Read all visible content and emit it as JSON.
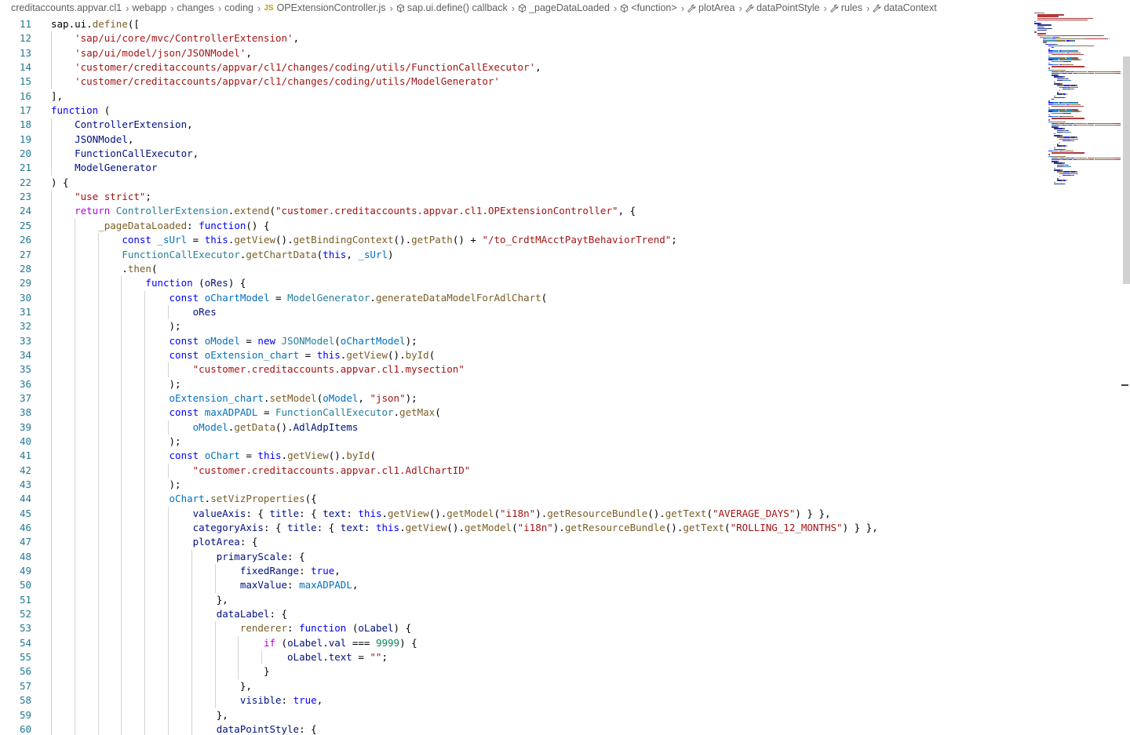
{
  "breadcrumb": [
    {
      "label": "creditaccounts.appvar.cl1",
      "icon": ""
    },
    {
      "label": "webapp",
      "icon": ""
    },
    {
      "label": "changes",
      "icon": ""
    },
    {
      "label": "coding",
      "icon": ""
    },
    {
      "label": "OPExtensionController.js",
      "icon": "js-file-icon"
    },
    {
      "label": "sap.ui.define() callback",
      "icon": "cube-icon"
    },
    {
      "label": "_pageDataLoaded",
      "icon": "cube-icon"
    },
    {
      "label": "<function>",
      "icon": "cube-icon"
    },
    {
      "label": "plotArea",
      "icon": "wrench-icon"
    },
    {
      "label": "dataPointStyle",
      "icon": "wrench-icon"
    },
    {
      "label": "rules",
      "icon": "wrench-icon"
    },
    {
      "label": "dataContext",
      "icon": "wrench-icon"
    }
  ],
  "js_badge": "JS",
  "colors": {
    "keyword": "#0000ff",
    "control": "#af00db",
    "string": "#a31515",
    "number": "#098658",
    "variable": "#0070c1",
    "function": "#795e26",
    "property": "#001080",
    "class": "#267f99",
    "line_number": "#237893"
  },
  "code_lines": [
    {
      "n": "11",
      "indent": 0,
      "tokens": [
        [
          "pl",
          "sap.ui."
        ],
        [
          "fn",
          "define"
        ],
        [
          "pl",
          "(["
        ]
      ]
    },
    {
      "n": "12",
      "indent": 1,
      "tokens": [
        [
          "str",
          "'sap/ui/core/mvc/ControllerExtension'"
        ],
        [
          "pl",
          ","
        ]
      ]
    },
    {
      "n": "13",
      "indent": 1,
      "tokens": [
        [
          "str",
          "'sap/ui/model/json/JSONModel'"
        ],
        [
          "pl",
          ","
        ]
      ]
    },
    {
      "n": "14",
      "indent": 1,
      "tokens": [
        [
          "str",
          "'customer/creditaccounts/appvar/cl1/changes/coding/utils/FunctionCallExecutor'"
        ],
        [
          "pl",
          ","
        ]
      ]
    },
    {
      "n": "15",
      "indent": 1,
      "tokens": [
        [
          "str",
          "'customer/creditaccounts/appvar/cl1/changes/coding/utils/ModelGenerator'"
        ]
      ]
    },
    {
      "n": "16",
      "indent": 0,
      "tokens": [
        [
          "pl",
          "],"
        ]
      ]
    },
    {
      "n": "17",
      "indent": 0,
      "tokens": [
        [
          "key",
          "function"
        ],
        [
          "pl",
          " ("
        ]
      ]
    },
    {
      "n": "18",
      "indent": 1,
      "tokens": [
        [
          "prop",
          "ControllerExtension"
        ],
        [
          "pl",
          ","
        ]
      ]
    },
    {
      "n": "19",
      "indent": 1,
      "tokens": [
        [
          "prop",
          "JSONModel"
        ],
        [
          "pl",
          ","
        ]
      ]
    },
    {
      "n": "20",
      "indent": 1,
      "tokens": [
        [
          "prop",
          "FunctionCallExecutor"
        ],
        [
          "pl",
          ","
        ]
      ]
    },
    {
      "n": "21",
      "indent": 1,
      "tokens": [
        [
          "prop",
          "ModelGenerator"
        ]
      ]
    },
    {
      "n": "22",
      "indent": 0,
      "tokens": [
        [
          "pl",
          ") {"
        ]
      ]
    },
    {
      "n": "23",
      "indent": 1,
      "tokens": [
        [
          "str",
          "\"use strict\""
        ],
        [
          "pl",
          ";"
        ]
      ]
    },
    {
      "n": "24",
      "indent": 1,
      "tokens": [
        [
          "ctl",
          "return"
        ],
        [
          "pl",
          " "
        ],
        [
          "cls",
          "ControllerExtension"
        ],
        [
          "pl",
          "."
        ],
        [
          "fn",
          "extend"
        ],
        [
          "pl",
          "("
        ],
        [
          "str",
          "\"customer.creditaccounts.appvar.cl1.OPExtensionController\""
        ],
        [
          "pl",
          ", {"
        ]
      ]
    },
    {
      "n": "25",
      "indent": 2,
      "tokens": [
        [
          "fn",
          "_pageDataLoaded"
        ],
        [
          "pl",
          ": "
        ],
        [
          "key",
          "function"
        ],
        [
          "pl",
          "() {"
        ]
      ]
    },
    {
      "n": "26",
      "indent": 3,
      "tokens": [
        [
          "key",
          "const"
        ],
        [
          "pl",
          " "
        ],
        [
          "var",
          "_sUrl"
        ],
        [
          "pl",
          " = "
        ],
        [
          "key",
          "this"
        ],
        [
          "pl",
          "."
        ],
        [
          "fn",
          "getView"
        ],
        [
          "pl",
          "()."
        ],
        [
          "fn",
          "getBindingContext"
        ],
        [
          "pl",
          "()."
        ],
        [
          "fn",
          "getPath"
        ],
        [
          "pl",
          "() + "
        ],
        [
          "str",
          "\"/to_CrdtMAcctPaytBehaviorTrend\""
        ],
        [
          "pl",
          ";"
        ]
      ]
    },
    {
      "n": "27",
      "indent": 3,
      "tokens": [
        [
          "cls",
          "FunctionCallExecutor"
        ],
        [
          "pl",
          "."
        ],
        [
          "fn",
          "getChartData"
        ],
        [
          "pl",
          "("
        ],
        [
          "key",
          "this"
        ],
        [
          "pl",
          ", "
        ],
        [
          "var",
          "_sUrl"
        ],
        [
          "pl",
          ")"
        ]
      ]
    },
    {
      "n": "28",
      "indent": 3,
      "tokens": [
        [
          "pl",
          "."
        ],
        [
          "fn",
          "then"
        ],
        [
          "pl",
          "("
        ]
      ]
    },
    {
      "n": "29",
      "indent": 4,
      "tokens": [
        [
          "key",
          "function"
        ],
        [
          "pl",
          " ("
        ],
        [
          "prop",
          "oRes"
        ],
        [
          "pl",
          ") {"
        ]
      ]
    },
    {
      "n": "30",
      "indent": 5,
      "tokens": [
        [
          "key",
          "const"
        ],
        [
          "pl",
          " "
        ],
        [
          "var",
          "oChartModel"
        ],
        [
          "pl",
          " = "
        ],
        [
          "cls",
          "ModelGenerator"
        ],
        [
          "pl",
          "."
        ],
        [
          "fn",
          "generateDataModelForAdlChart"
        ],
        [
          "pl",
          "("
        ]
      ]
    },
    {
      "n": "31",
      "indent": 6,
      "tokens": [
        [
          "prop",
          "oRes"
        ]
      ]
    },
    {
      "n": "32",
      "indent": 5,
      "tokens": [
        [
          "pl",
          ");"
        ]
      ]
    },
    {
      "n": "33",
      "indent": 5,
      "tokens": [
        [
          "key",
          "const"
        ],
        [
          "pl",
          " "
        ],
        [
          "var",
          "oModel"
        ],
        [
          "pl",
          " = "
        ],
        [
          "key",
          "new"
        ],
        [
          "pl",
          " "
        ],
        [
          "cls",
          "JSONModel"
        ],
        [
          "pl",
          "("
        ],
        [
          "var",
          "oChartModel"
        ],
        [
          "pl",
          ");"
        ]
      ]
    },
    {
      "n": "34",
      "indent": 5,
      "tokens": [
        [
          "key",
          "const"
        ],
        [
          "pl",
          " "
        ],
        [
          "var",
          "oExtension_chart"
        ],
        [
          "pl",
          " = "
        ],
        [
          "key",
          "this"
        ],
        [
          "pl",
          "."
        ],
        [
          "fn",
          "getView"
        ],
        [
          "pl",
          "()."
        ],
        [
          "fn",
          "byId"
        ],
        [
          "pl",
          "("
        ]
      ]
    },
    {
      "n": "35",
      "indent": 6,
      "tokens": [
        [
          "str",
          "\"customer.creditaccounts.appvar.cl1.mysection\""
        ]
      ]
    },
    {
      "n": "36",
      "indent": 5,
      "tokens": [
        [
          "pl",
          ");"
        ]
      ]
    },
    {
      "n": "37",
      "indent": 5,
      "tokens": [
        [
          "var",
          "oExtension_chart"
        ],
        [
          "pl",
          "."
        ],
        [
          "fn",
          "setModel"
        ],
        [
          "pl",
          "("
        ],
        [
          "var",
          "oModel"
        ],
        [
          "pl",
          ", "
        ],
        [
          "str",
          "\"json\""
        ],
        [
          "pl",
          ");"
        ]
      ]
    },
    {
      "n": "38",
      "indent": 5,
      "tokens": [
        [
          "key",
          "const"
        ],
        [
          "pl",
          " "
        ],
        [
          "var",
          "maxADPADL"
        ],
        [
          "pl",
          " = "
        ],
        [
          "cls",
          "FunctionCallExecutor"
        ],
        [
          "pl",
          "."
        ],
        [
          "fn",
          "getMax"
        ],
        [
          "pl",
          "("
        ]
      ]
    },
    {
      "n": "39",
      "indent": 6,
      "tokens": [
        [
          "var",
          "oModel"
        ],
        [
          "pl",
          "."
        ],
        [
          "fn",
          "getData"
        ],
        [
          "pl",
          "()."
        ],
        [
          "prop",
          "AdlAdpItems"
        ]
      ]
    },
    {
      "n": "40",
      "indent": 5,
      "tokens": [
        [
          "pl",
          ");"
        ]
      ]
    },
    {
      "n": "41",
      "indent": 5,
      "tokens": [
        [
          "key",
          "const"
        ],
        [
          "pl",
          " "
        ],
        [
          "var",
          "oChart"
        ],
        [
          "pl",
          " = "
        ],
        [
          "key",
          "this"
        ],
        [
          "pl",
          "."
        ],
        [
          "fn",
          "getView"
        ],
        [
          "pl",
          "()."
        ],
        [
          "fn",
          "byId"
        ],
        [
          "pl",
          "("
        ]
      ]
    },
    {
      "n": "42",
      "indent": 6,
      "tokens": [
        [
          "str",
          "\"customer.creditaccounts.appvar.cl1.AdlChartID\""
        ]
      ]
    },
    {
      "n": "43",
      "indent": 5,
      "tokens": [
        [
          "pl",
          ");"
        ]
      ]
    },
    {
      "n": "44",
      "indent": 5,
      "tokens": [
        [
          "var",
          "oChart"
        ],
        [
          "pl",
          "."
        ],
        [
          "fn",
          "setVizProperties"
        ],
        [
          "pl",
          "({"
        ]
      ]
    },
    {
      "n": "45",
      "indent": 6,
      "tokens": [
        [
          "prop",
          "valueAxis"
        ],
        [
          "pl",
          ": { "
        ],
        [
          "prop",
          "title"
        ],
        [
          "pl",
          ": { "
        ],
        [
          "prop",
          "text"
        ],
        [
          "pl",
          ": "
        ],
        [
          "key",
          "this"
        ],
        [
          "pl",
          "."
        ],
        [
          "fn",
          "getView"
        ],
        [
          "pl",
          "()."
        ],
        [
          "fn",
          "getModel"
        ],
        [
          "pl",
          "("
        ],
        [
          "str",
          "\"i18n\""
        ],
        [
          "pl",
          ")."
        ],
        [
          "fn",
          "getResourceBundle"
        ],
        [
          "pl",
          "()."
        ],
        [
          "fn",
          "getText"
        ],
        [
          "pl",
          "("
        ],
        [
          "str",
          "\"AVERAGE_DAYS\""
        ],
        [
          "pl",
          ") } },"
        ]
      ]
    },
    {
      "n": "46",
      "indent": 6,
      "tokens": [
        [
          "prop",
          "categoryAxis"
        ],
        [
          "pl",
          ": { "
        ],
        [
          "prop",
          "title"
        ],
        [
          "pl",
          ": { "
        ],
        [
          "prop",
          "text"
        ],
        [
          "pl",
          ": "
        ],
        [
          "key",
          "this"
        ],
        [
          "pl",
          "."
        ],
        [
          "fn",
          "getView"
        ],
        [
          "pl",
          "()."
        ],
        [
          "fn",
          "getModel"
        ],
        [
          "pl",
          "("
        ],
        [
          "str",
          "\"i18n\""
        ],
        [
          "pl",
          ")."
        ],
        [
          "fn",
          "getResourceBundle"
        ],
        [
          "pl",
          "()."
        ],
        [
          "fn",
          "getText"
        ],
        [
          "pl",
          "("
        ],
        [
          "str",
          "\"ROLLING_12_MONTHS\""
        ],
        [
          "pl",
          ") } },"
        ]
      ]
    },
    {
      "n": "47",
      "indent": 6,
      "tokens": [
        [
          "prop",
          "plotArea"
        ],
        [
          "pl",
          ": {"
        ]
      ]
    },
    {
      "n": "48",
      "indent": 7,
      "tokens": [
        [
          "prop",
          "primaryScale"
        ],
        [
          "pl",
          ": {"
        ]
      ]
    },
    {
      "n": "49",
      "indent": 8,
      "tokens": [
        [
          "prop",
          "fixedRange"
        ],
        [
          "pl",
          ": "
        ],
        [
          "key",
          "true"
        ],
        [
          "pl",
          ","
        ]
      ]
    },
    {
      "n": "50",
      "indent": 8,
      "tokens": [
        [
          "prop",
          "maxValue"
        ],
        [
          "pl",
          ": "
        ],
        [
          "var",
          "maxADPADL"
        ],
        [
          "pl",
          ","
        ]
      ]
    },
    {
      "n": "51",
      "indent": 7,
      "tokens": [
        [
          "pl",
          "},"
        ]
      ]
    },
    {
      "n": "52",
      "indent": 7,
      "tokens": [
        [
          "prop",
          "dataLabel"
        ],
        [
          "pl",
          ": {"
        ]
      ]
    },
    {
      "n": "53",
      "indent": 8,
      "tokens": [
        [
          "fn",
          "renderer"
        ],
        [
          "pl",
          ": "
        ],
        [
          "key",
          "function"
        ],
        [
          "pl",
          " ("
        ],
        [
          "prop",
          "oLabel"
        ],
        [
          "pl",
          ") {"
        ]
      ]
    },
    {
      "n": "54",
      "indent": 9,
      "tokens": [
        [
          "ctl",
          "if"
        ],
        [
          "pl",
          " ("
        ],
        [
          "prop",
          "oLabel"
        ],
        [
          "pl",
          "."
        ],
        [
          "prop",
          "val"
        ],
        [
          "pl",
          " === "
        ],
        [
          "num",
          "9999"
        ],
        [
          "pl",
          ") {"
        ]
      ]
    },
    {
      "n": "55",
      "indent": 10,
      "tokens": [
        [
          "prop",
          "oLabel"
        ],
        [
          "pl",
          "."
        ],
        [
          "prop",
          "text"
        ],
        [
          "pl",
          " = "
        ],
        [
          "str",
          "\"\""
        ],
        [
          "pl",
          ";"
        ]
      ]
    },
    {
      "n": "56",
      "indent": 9,
      "tokens": [
        [
          "pl",
          "}"
        ]
      ]
    },
    {
      "n": "57",
      "indent": 8,
      "tokens": [
        [
          "pl",
          "},"
        ]
      ]
    },
    {
      "n": "58",
      "indent": 8,
      "tokens": [
        [
          "prop",
          "visible"
        ],
        [
          "pl",
          ": "
        ],
        [
          "key",
          "true"
        ],
        [
          "pl",
          ","
        ]
      ]
    },
    {
      "n": "59",
      "indent": 7,
      "tokens": [
        [
          "pl",
          "},"
        ]
      ]
    },
    {
      "n": "60",
      "indent": 7,
      "tokens": [
        [
          "prop",
          "dataPointStyle"
        ],
        [
          "pl",
          ": {"
        ]
      ]
    }
  ]
}
